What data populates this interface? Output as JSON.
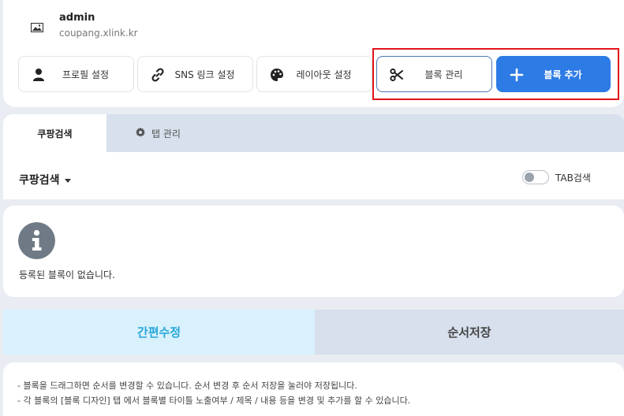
{
  "profile": {
    "name": "admin",
    "url": "coupang.xlink.kr",
    "icon": "image-icon"
  },
  "toolbar": {
    "profile_settings": "프로필 설정",
    "sns_settings": "SNS 링크 설정",
    "layout_settings": "레이아웃 설정",
    "block_manage": "블록 관리",
    "block_add": "블록 추가",
    "icons": [
      "user-icon",
      "link-icon",
      "palette-icon",
      "scissors-icon",
      "plus-icon"
    ],
    "accent_color": "#2d7be5",
    "highlight_color": "#e0161c"
  },
  "tabs": {
    "active": "쿠팡검색",
    "manage": "탭 관리"
  },
  "selector": {
    "selected": "쿠팡검색",
    "toggle_label": "TAB검색",
    "toggle_on": false
  },
  "info": {
    "message": "등록된 블록이 없습니다."
  },
  "actions": {
    "quick_edit": "간편수정",
    "save_order": "순서저장"
  },
  "notes": [
    "- 블록을 드래그하면 순서를 변경할 수 있습니다. 순서 변경 후 순서 저장을 눌러야 저장됩니다.",
    "- 각 블록의 [블록 디자인] 탭 에서 블록별 타이틀 노출여부 / 제목 / 내용 등을 변경 및 추가를 할 수 있습니다."
  ]
}
